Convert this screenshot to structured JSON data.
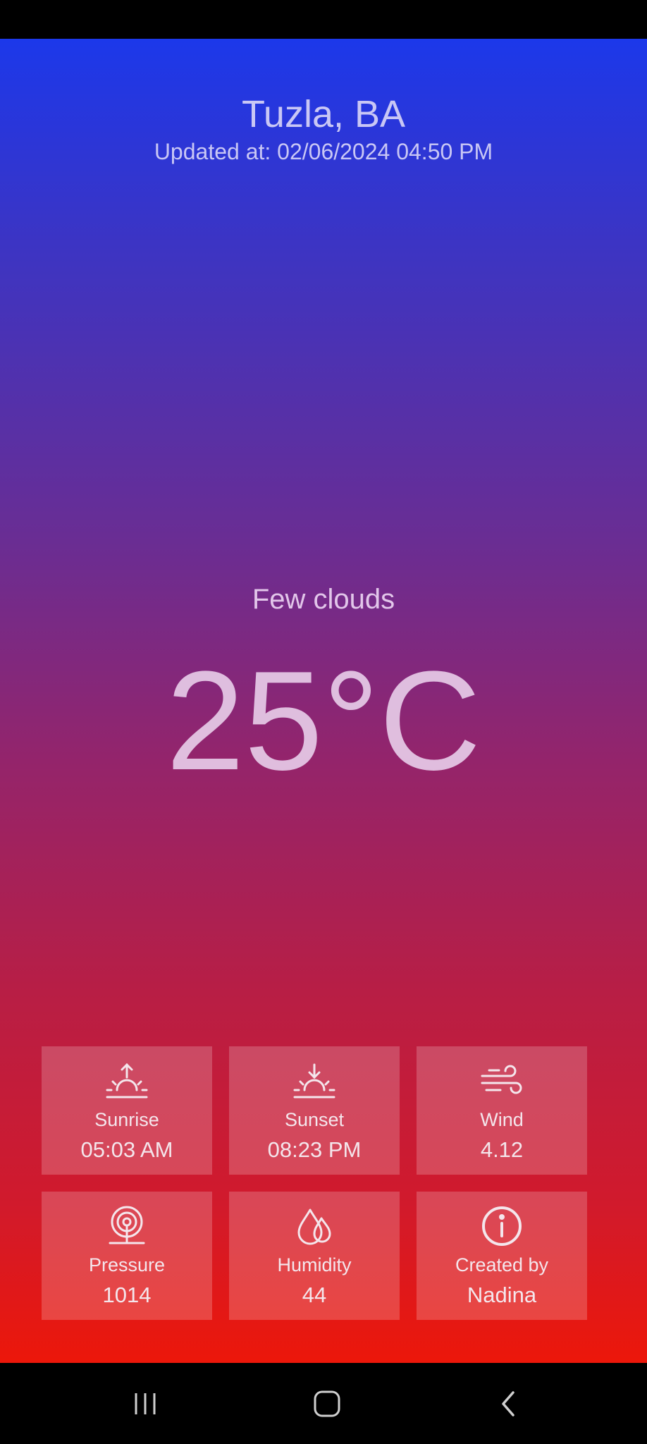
{
  "header": {
    "location": "Tuzla, BA",
    "updated": "Updated at: 02/06/2024 04:50 PM"
  },
  "weather": {
    "condition": "Few clouds",
    "temperature": "25°C"
  },
  "cards": [
    {
      "label": "Sunrise",
      "value": "05:03 AM",
      "icon": "sunrise-icon"
    },
    {
      "label": "Sunset",
      "value": "08:23 PM",
      "icon": "sunset-icon"
    },
    {
      "label": "Wind",
      "value": "4.12",
      "icon": "wind-icon"
    },
    {
      "label": "Pressure",
      "value": "1014",
      "icon": "pressure-icon"
    },
    {
      "label": "Humidity",
      "value": "44",
      "icon": "humidity-icon"
    },
    {
      "label": "Created by",
      "value": "Nadina",
      "icon": "info-icon"
    }
  ],
  "navigation": {
    "buttons": [
      "recent-apps-icon",
      "home-icon",
      "back-icon"
    ]
  },
  "colors": {
    "gradient_top": "#1c38ea",
    "gradient_bottom": "#ec170a",
    "card_bg": "rgba(255,255,255,0.2)"
  }
}
